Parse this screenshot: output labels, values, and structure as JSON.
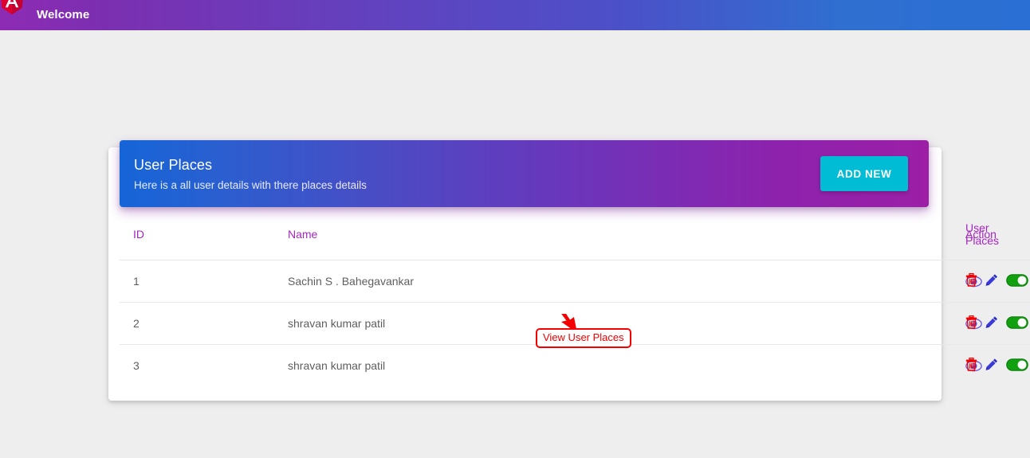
{
  "toolbar": {
    "logo_icon": "angular-shield-icon",
    "title": "Welcome"
  },
  "card": {
    "title": "User Places",
    "subtitle": "Here is a all user details with there places details",
    "add_new_label": "ADD NEW"
  },
  "table": {
    "columns": [
      "ID",
      "Name",
      "User Places",
      "Action"
    ],
    "rows": [
      {
        "id": "1",
        "name": "Sachin S . Bahegavankar",
        "view_icon": "eye-icon",
        "actions": [
          "trash-icon",
          "pencil-icon",
          "toggle-on-icon"
        ]
      },
      {
        "id": "2",
        "name": "shravan kumar patil",
        "view_icon": "eye-icon",
        "actions": [
          "trash-icon",
          "pencil-icon",
          "toggle-on-icon"
        ]
      },
      {
        "id": "3",
        "name": "shravan kumar patil",
        "view_icon": "eye-icon",
        "actions": [
          "trash-icon",
          "pencil-icon",
          "toggle-on-icon"
        ]
      }
    ]
  },
  "annotation": {
    "label": "View User Places",
    "color": "#f40000",
    "arrow_icon": "arrow-pointer-icon"
  },
  "colors": {
    "toolbar_gradient_start": "#8e2bb5",
    "toolbar_gradient_end": "#2a6fd4",
    "card_header_gradient_start": "#1565d8",
    "card_header_gradient_end": "#9c1fa6",
    "accent_button": "#00bcd4",
    "table_header_text": "#a426c0",
    "eye_icon": "#5b4bd6",
    "trash_icon": "#f40000",
    "pencil_icon": "#2b2bc4",
    "toggle_on": "#11a10f",
    "page_background": "#eeeeee"
  }
}
